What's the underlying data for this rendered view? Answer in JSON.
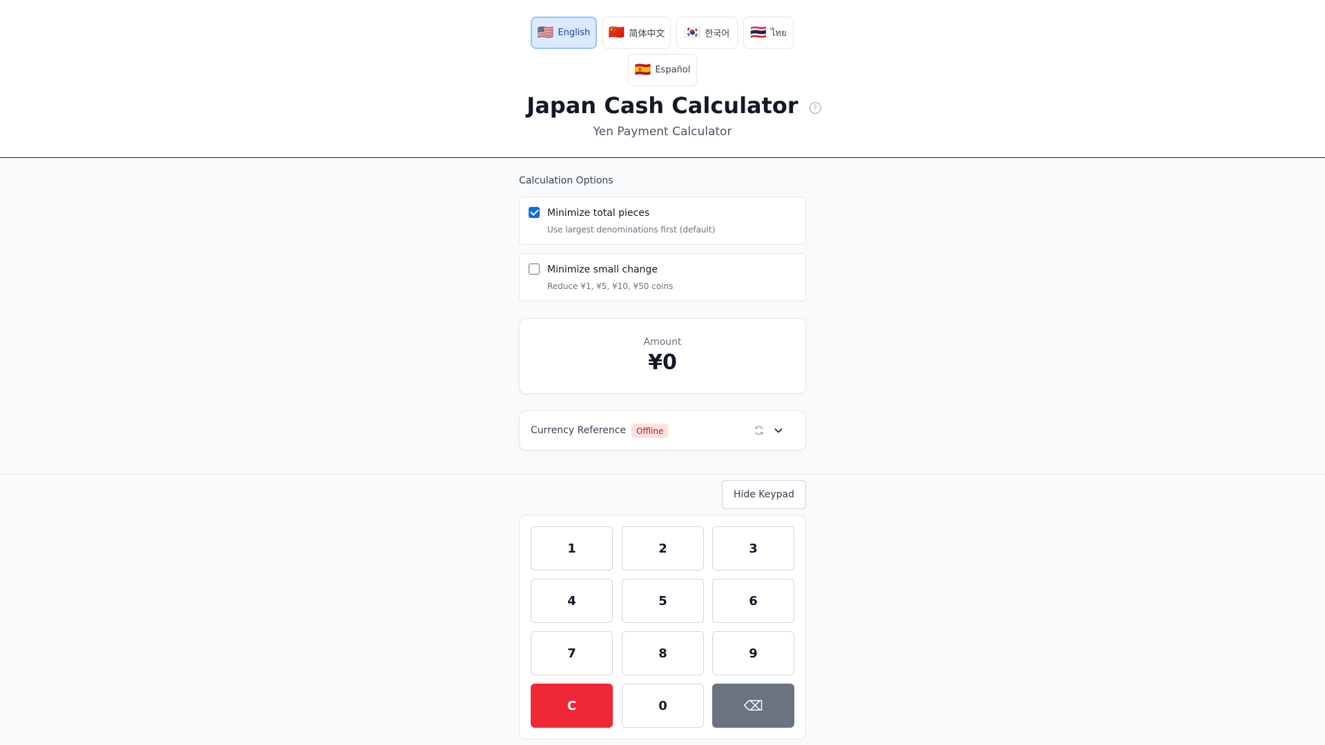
{
  "languages": [
    {
      "flag": "🇺🇸",
      "label": "English",
      "active": true
    },
    {
      "flag": "🇨🇳",
      "label": "简体中文",
      "active": false
    },
    {
      "flag": "🇰🇷",
      "label": "한국어",
      "active": false
    },
    {
      "flag": "🇹🇭",
      "label": "ไทย",
      "active": false
    },
    {
      "flag": "🇪🇸",
      "label": "Español",
      "active": false
    }
  ],
  "header": {
    "title": "Japan Cash Calculator",
    "help_glyph": "?",
    "subtitle": "Yen Payment Calculator"
  },
  "options": {
    "section_label": "Calculation Options",
    "items": [
      {
        "title": "Minimize total pieces",
        "desc": "Use largest denominations first (default)",
        "checked": true
      },
      {
        "title": "Minimize small change",
        "desc": "Reduce ¥1, ¥5, ¥10, ¥50 coins",
        "checked": false
      }
    ]
  },
  "amount": {
    "label": "Amount",
    "value": "¥0"
  },
  "currency": {
    "label": "Currency Reference",
    "status": "Offline",
    "icons": [
      "refresh-icon",
      "chevron-down-icon"
    ]
  },
  "keypad": {
    "toggle_label": "Hide Keypad",
    "keys": [
      "1",
      "2",
      "3",
      "4",
      "5",
      "6",
      "7",
      "8",
      "9",
      "C",
      "0",
      "⌫"
    ]
  },
  "colors": {
    "accent": "#0b6ce3",
    "clear": "#ef2837",
    "backspace": "#6b7280",
    "offline_badge_bg": "#fee2e2",
    "offline_badge_text": "#b91c1c"
  }
}
